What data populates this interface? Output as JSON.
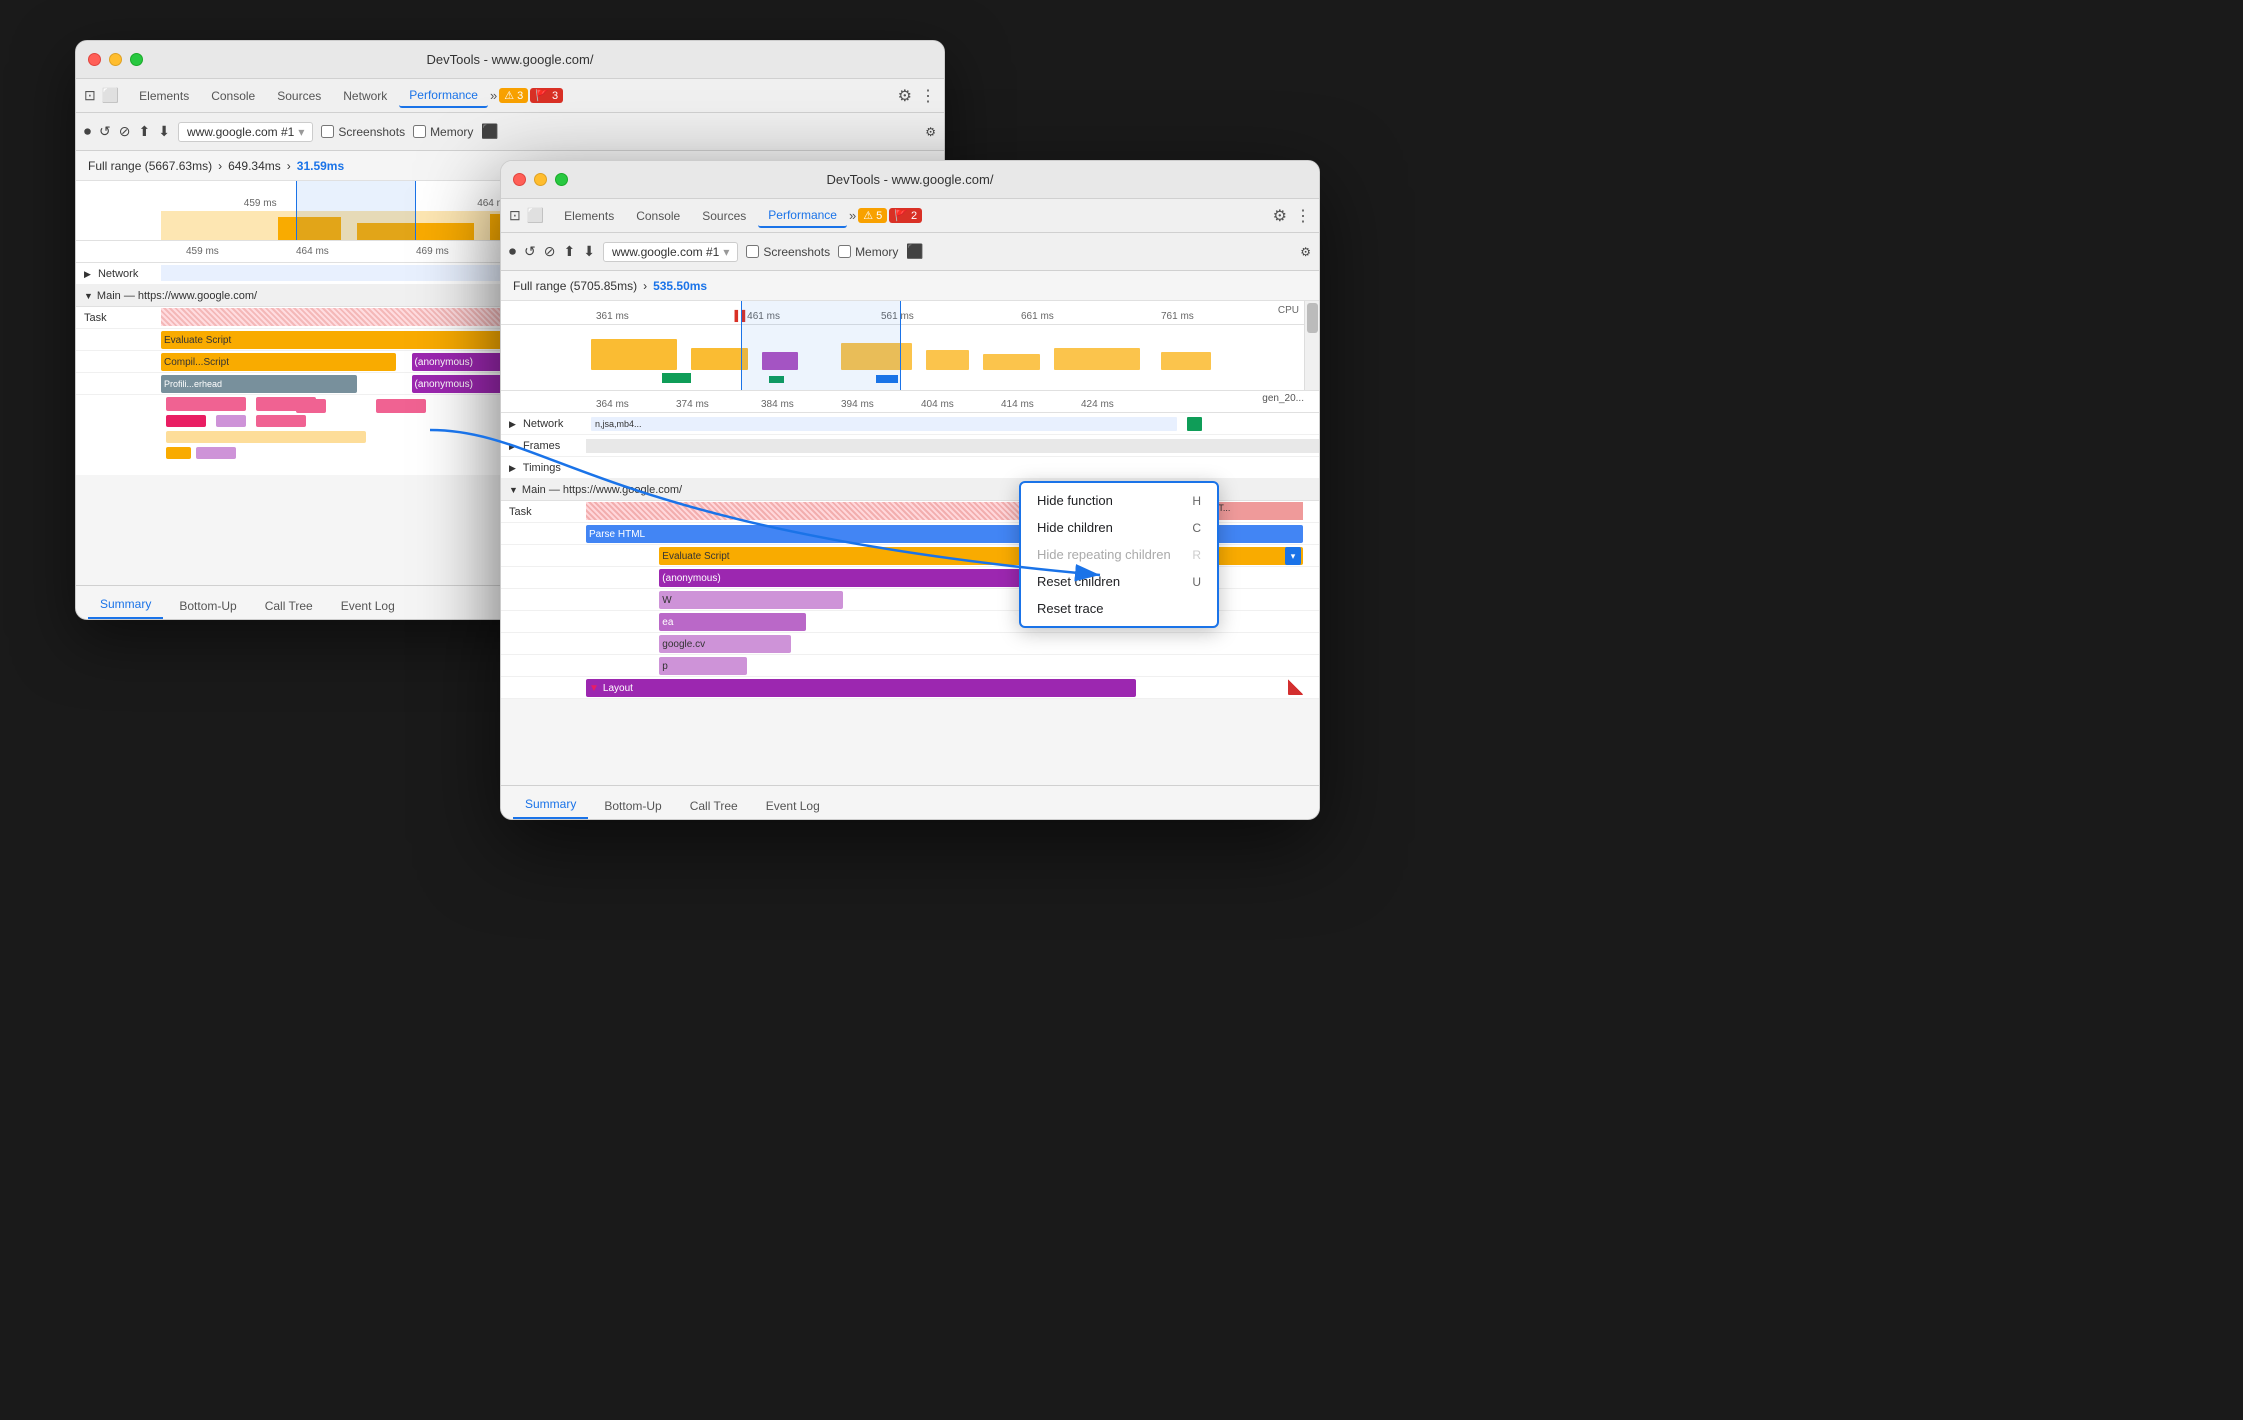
{
  "bg_window": {
    "title": "DevTools - www.google.com/",
    "tabs": [
      "Elements",
      "Console",
      "Sources",
      "Network",
      "Performance"
    ],
    "active_tab": "Performance",
    "warnings": "3",
    "errors": "3",
    "range_label": "Full range (5667.63ms)",
    "range_arrow": ">",
    "range_selected": "649.34ms",
    "range_arrow2": ">",
    "range_highlighted": "31.59ms",
    "ruler_marks": [
      "459 ms",
      "464 ms",
      "469 ms"
    ],
    "sections": {
      "network": "Network",
      "main": "Main — https://www.google.com/",
      "task_label": "Task",
      "evaluate_script": "Evaluate Script",
      "compile_script": "Compil...Script",
      "anonymous1": "(anonymous)",
      "profil_erhead": "Profili...erhead",
      "anonymous2": "(anonymous)",
      "anonymous3": "(anonymous)"
    },
    "bottom_tabs": [
      "Summary",
      "Bottom-Up",
      "Call Tree",
      "Event Log"
    ],
    "active_bottom_tab": "Summary",
    "toolbar": {
      "url": "www.google.com #1",
      "screenshots_label": "Screenshots",
      "memory_label": "Memory"
    }
  },
  "fg_window": {
    "title": "DevTools - www.google.com/",
    "tabs": [
      "Elements",
      "Console",
      "Sources",
      "Performance"
    ],
    "active_tab": "Performance",
    "warnings": "5",
    "errors": "2",
    "range_label": "Full range (5705.85ms)",
    "range_arrow": ">",
    "range_highlighted": "535.50ms",
    "ruler_marks": [
      "361 ms",
      "461 ms",
      "561 ms",
      "661 ms",
      "761 ms"
    ],
    "ruler_sub_marks": [
      "364 ms",
      "374 ms",
      "384 ms",
      "394 ms",
      "404 ms",
      "414 ms",
      "424 ms"
    ],
    "sections": {
      "network": "Network",
      "network_files": "n,jsa,mb4...",
      "frames": "Frames",
      "timings": "Timings",
      "main": "Main — https://www.google.com/",
      "task_label": "Task",
      "parse_html": "Parse HTML",
      "evaluate_script": "Evaluate Script",
      "anonymous": "(anonymous)",
      "w_label": "W",
      "ea_label": "ea",
      "google_cv": "google.cv",
      "p_label": "p",
      "layout": "Layout",
      "gen_label": "gen_20..."
    },
    "bottom_tabs": [
      "Summary",
      "Bottom-Up",
      "Call Tree",
      "Event Log"
    ],
    "active_bottom_tab": "Summary",
    "toolbar": {
      "url": "www.google.com #1",
      "screenshots_label": "Screenshots",
      "memory_label": "Memory"
    }
  },
  "context_menu": {
    "items": [
      {
        "label": "Hide function",
        "shortcut": "H",
        "disabled": false
      },
      {
        "label": "Hide children",
        "shortcut": "C",
        "disabled": false
      },
      {
        "label": "Hide repeating children",
        "shortcut": "R",
        "disabled": true
      },
      {
        "label": "Reset children",
        "shortcut": "U",
        "disabled": false
      },
      {
        "label": "Reset trace",
        "shortcut": "",
        "disabled": false
      }
    ]
  },
  "colors": {
    "blue_accent": "#1a73e8",
    "yellow_flame": "#f9ab00",
    "purple_flame": "#9c27b0",
    "blue_flame": "#4285f4",
    "green_net": "#0f9d58",
    "red_traffic": "#ff5f57",
    "yellow_traffic": "#ffbd2e",
    "green_traffic": "#28c840",
    "task_stripe": "#e57373",
    "parse_html_blue": "#4285f4",
    "evaluate_yellow": "#f9ab00",
    "pink_flame": "#e91e63",
    "gray_flame": "#9e9e9e"
  }
}
